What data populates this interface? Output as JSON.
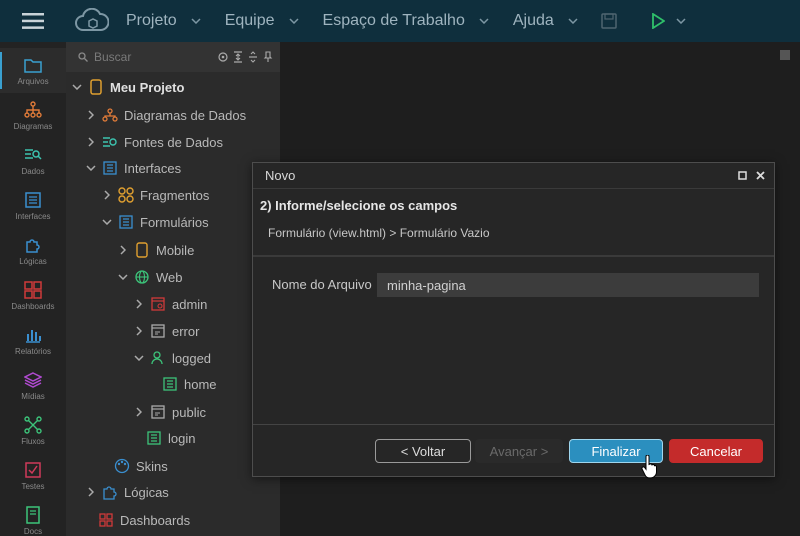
{
  "topbar": {
    "menu": [
      {
        "label": "Projeto"
      },
      {
        "label": "Equipe"
      },
      {
        "label": "Espaço de Trabalho"
      },
      {
        "label": "Ajuda"
      }
    ]
  },
  "rail": {
    "items": [
      {
        "label": "Arquivos",
        "icon": "folder-icon"
      },
      {
        "label": "Diagramas",
        "icon": "diagram-icon"
      },
      {
        "label": "Dados",
        "icon": "data-icon"
      },
      {
        "label": "Interfaces",
        "icon": "interface-icon"
      },
      {
        "label": "Lógicas",
        "icon": "puzzle-icon"
      },
      {
        "label": "Dashboards",
        "icon": "dashboard-icon"
      },
      {
        "label": "Relatórios",
        "icon": "chart-icon"
      },
      {
        "label": "Mídias",
        "icon": "layers-icon"
      },
      {
        "label": "Fluxos",
        "icon": "flow-icon"
      },
      {
        "label": "Testes",
        "icon": "check-icon"
      },
      {
        "label": "Docs",
        "icon": "book-icon"
      }
    ]
  },
  "explorer": {
    "search_placeholder": "Buscar",
    "tree": [
      {
        "label": "Meu Projeto"
      },
      {
        "label": "Diagramas de Dados"
      },
      {
        "label": "Fontes de Dados"
      },
      {
        "label": "Interfaces"
      },
      {
        "label": "Fragmentos"
      },
      {
        "label": "Formulários"
      },
      {
        "label": "Mobile"
      },
      {
        "label": "Web"
      },
      {
        "label": "admin"
      },
      {
        "label": "error"
      },
      {
        "label": "logged"
      },
      {
        "label": "home"
      },
      {
        "label": "public"
      },
      {
        "label": "login"
      },
      {
        "label": "Skins"
      },
      {
        "label": "Lógicas"
      },
      {
        "label": "Dashboards"
      }
    ]
  },
  "dialog": {
    "title": "Novo",
    "step": "2) Informe/selecione os campos",
    "path": "Formulário (view.html) > Formulário Vazio",
    "field_label": "Nome do Arquivo",
    "field_value": "minha-pagina",
    "buttons": {
      "back": "< Voltar",
      "next": "Avançar >",
      "finish": "Finalizar",
      "cancel": "Cancelar"
    }
  },
  "colors": {
    "topbar": "#0f2f3d",
    "accent_blue": "#2b8fbf",
    "cancel_red": "#c42b2b",
    "rail_active": "#3aa0d0"
  }
}
